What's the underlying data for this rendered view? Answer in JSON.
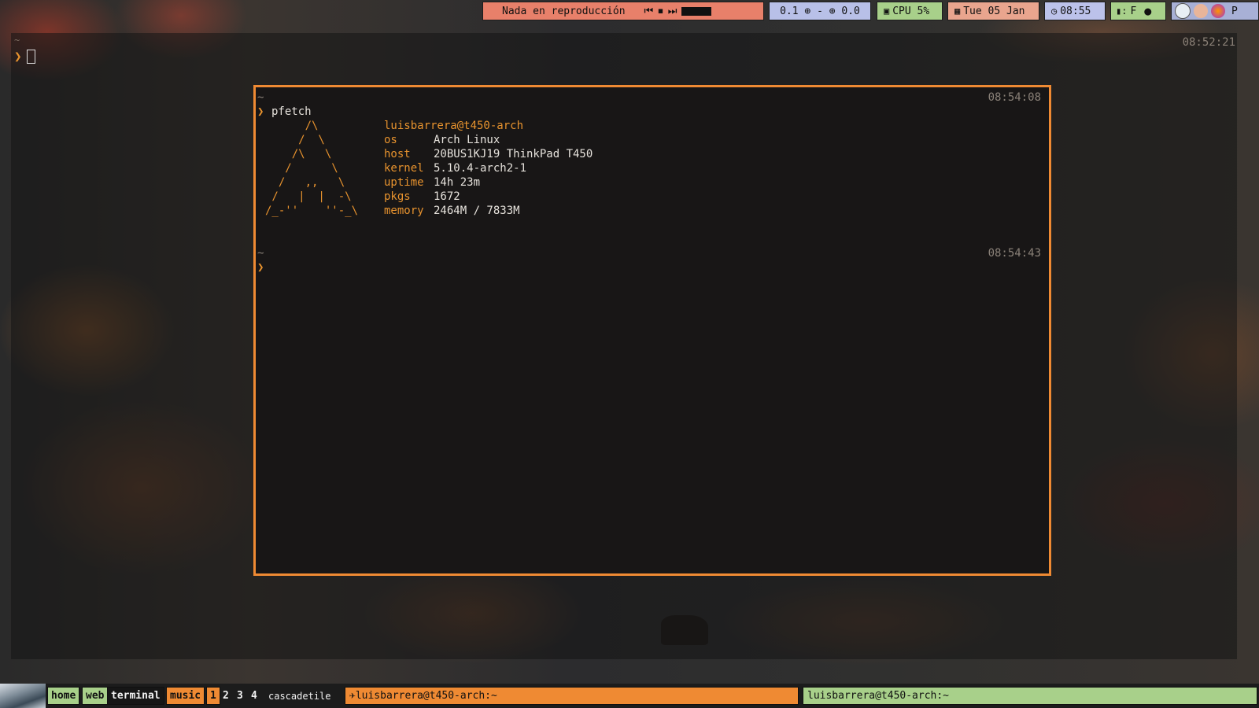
{
  "desktop": {
    "bg_terminal": {
      "tilde": "~",
      "prompt": "❯",
      "time": "08:52:21"
    }
  },
  "topbar": {
    "media": {
      "status": "Nada en reproducción",
      "controls": [
        "⏮",
        "⏹",
        "⏭"
      ]
    },
    "network": {
      "down": "0.1",
      "separator": "-",
      "up": "0.0",
      "down_icon": "download-icon",
      "up_icon": "upload-icon"
    },
    "cpu": {
      "label": "CPU 5%",
      "icon": "chip-icon"
    },
    "date": {
      "label": "Tue 05 Jan",
      "icon": "calendar-icon"
    },
    "clock": {
      "label": "08:55",
      "icon": "clock-icon"
    },
    "battery": {
      "label": "F",
      "icon": "battery-icon"
    },
    "tray": [
      "network-tray-icon",
      "bluetooth-tray-icon",
      "firefox-tray-icon",
      "package-tray-icon"
    ],
    "tray_last": "P",
    "colors": {
      "media": "#e8806a",
      "net": "#b8c0e8",
      "cpu": "#a8d08a",
      "date": "#e9a58e",
      "clock": "#bcc2ea",
      "bat": "#a8d08a"
    }
  },
  "terminal": {
    "block1": {
      "tilde": "~",
      "time": "08:54:08",
      "prompt": "❯",
      "command": "pfetch"
    },
    "art": [
      "      /\\",
      "     /  \\",
      "    /\\   \\",
      "   /      \\",
      "  /   ,,   \\",
      " /   |  |  -\\",
      "/_-''    ''-_\\"
    ],
    "user_host": "luisbarrera@t450-arch",
    "info": [
      {
        "key": "os",
        "value": "Arch Linux"
      },
      {
        "key": "host",
        "value": "20BUS1KJ19 ThinkPad T450"
      },
      {
        "key": "kernel",
        "value": "5.10.4-arch2-1"
      },
      {
        "key": "uptime",
        "value": "14h 23m"
      },
      {
        "key": "pkgs",
        "value": "1672"
      },
      {
        "key": "memory",
        "value": "2464M / 7833M"
      }
    ],
    "block2": {
      "tilde": "~",
      "time": "08:54:43",
      "prompt": "❯"
    },
    "border_color": "#ef8a33"
  },
  "bottombar": {
    "groups": [
      "home",
      "web",
      "terminal",
      "music"
    ],
    "numbers": [
      "1",
      "2",
      "3",
      "4"
    ],
    "layout": "cascadetile",
    "tasks": [
      "✈luisbarrera@t450-arch:~",
      "luisbarrera@t450-arch:~"
    ]
  }
}
